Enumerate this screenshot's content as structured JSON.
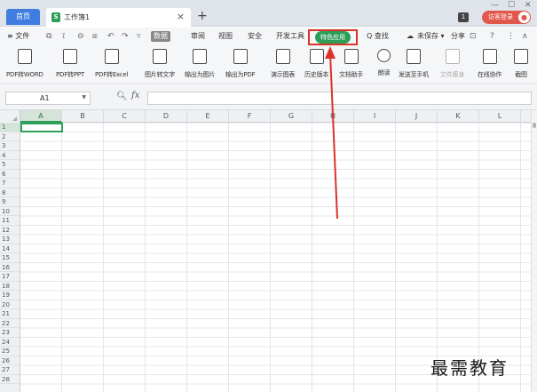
{
  "tabs": {
    "home": "首页",
    "document": "工作簿1",
    "close": "×",
    "add": "+"
  },
  "titlebar": {
    "badge": "1",
    "login": "访客登录",
    "min": "—",
    "max": "☐",
    "close": "✕"
  },
  "menu": {
    "file": "≡ 文件",
    "quick_access": [
      "⧉",
      "⟟",
      "⊖",
      "⧈",
      "↶",
      "↷",
      "▿"
    ],
    "items": [
      "数据",
      "审阅",
      "视图",
      "安全",
      "开发工具"
    ],
    "special": "特色应用",
    "search": "Q 查找",
    "unsaved": "未保存 ▾",
    "share": "分享",
    "help": "?",
    "more": "⋮",
    "collapse": "∧"
  },
  "ribbon": [
    {
      "label": "PDF转WORD",
      "icon": "pdf-to-word-icon"
    },
    {
      "label": "PDF转PPT",
      "icon": "pdf-to-ppt-icon"
    },
    {
      "label": "PDF转Excel",
      "icon": "pdf-to-excel-icon"
    },
    {
      "label": "图片转文字",
      "icon": "image-to-text-icon"
    },
    {
      "label": "输出为图片",
      "icon": "export-image-icon"
    },
    {
      "label": "输出为PDF",
      "icon": "export-pdf-icon"
    },
    {
      "label": "演示图表",
      "icon": "demo-chart-icon"
    },
    {
      "label": "历史版本",
      "icon": "history-version-icon"
    },
    {
      "label": "文档助手",
      "icon": "doc-assistant-icon"
    },
    {
      "label": "朗读",
      "icon": "read-aloud-icon"
    },
    {
      "label": "发送至手机",
      "icon": "send-to-phone-icon"
    },
    {
      "label": "文件瘦身",
      "icon": "file-slim-icon"
    },
    {
      "label": "在线协作",
      "icon": "online-collab-icon"
    },
    {
      "label": "截图",
      "icon": "screenshot-icon"
    }
  ],
  "formula": {
    "cell_ref": "A1",
    "fx": "fx",
    "content": ""
  },
  "grid": {
    "columns": [
      "A",
      "B",
      "C",
      "D",
      "E",
      "F",
      "G",
      "H",
      "I",
      "J",
      "K",
      "L"
    ],
    "rows": [
      "1",
      "2",
      "3",
      "4",
      "5",
      "6",
      "7",
      "8",
      "9",
      "10",
      "11",
      "12",
      "13",
      "14",
      "15",
      "16",
      "17",
      "18",
      "19",
      "20",
      "21",
      "22",
      "23",
      "24",
      "25",
      "26",
      "27",
      "28"
    ],
    "active_cell": "A1"
  },
  "watermark": "最需教育",
  "colors": {
    "accent_green": "#2e9e58",
    "tab_blue": "#3f7de0",
    "annotation_red": "#d9332a",
    "login_red": "#e2574c"
  }
}
